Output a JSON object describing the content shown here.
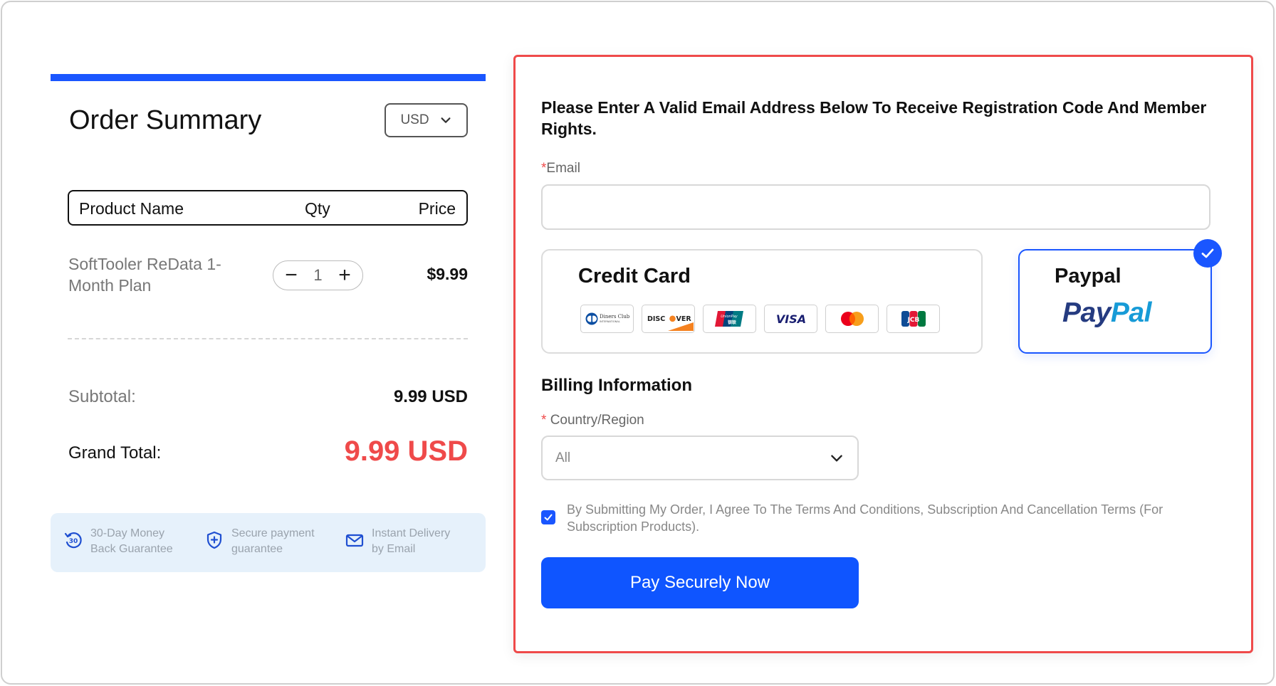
{
  "order": {
    "title": "Order Summary",
    "currency": "USD",
    "columns": {
      "name": "Product Name",
      "qty": "Qty",
      "price": "Price"
    },
    "product": {
      "name": "SoftTooler ReData 1-Month Plan",
      "qty": "1",
      "price": "$9.99",
      "minus": "−",
      "plus": "+"
    },
    "subtotal_label": "Subtotal:",
    "subtotal_value": "9.99 USD",
    "grand_label": "Grand Total:",
    "grand_value": "9.99 USD",
    "guarantees": [
      {
        "icon": "money-back-icon",
        "line1": "30-Day Money",
        "line2": "Back Guarantee"
      },
      {
        "icon": "shield-plus-icon",
        "line1": "Secure payment",
        "line2": "guarantee"
      },
      {
        "icon": "email-icon",
        "line1": "Instant Delivery",
        "line2": "by Email"
      }
    ]
  },
  "checkout": {
    "intro": "Please Enter A Valid Email Address Below To Receive Registration Code And Member Rights.",
    "email_label": "Email",
    "email_required_mark": "*",
    "email_value": "",
    "methods": {
      "credit_card": "Credit Card",
      "paypal": "Paypal",
      "paypal_logo_1": "Pay",
      "paypal_logo_2": "Pal",
      "selected": "paypal",
      "card_brands": [
        "Diners Club",
        "DISCOVER",
        "UnionPay",
        "VISA",
        "Mastercard",
        "JCB"
      ]
    },
    "billing_title": "Billing Information",
    "country_label": "Country/Region",
    "country_required_mark": "*",
    "country_value": "All",
    "agree_checked": true,
    "agree_text": "By Submitting My Order, I Agree To The Terms And Conditions, Subscription And Cancellation Terms (For Subscription Products).",
    "pay_button": "Pay Securely Now"
  },
  "colors": {
    "accent": "#1a56ff",
    "danger": "#ef4a4a",
    "guarantee_bg": "#e6f1fb",
    "paypal_dark": "#253b80",
    "paypal_light": "#179bd7"
  }
}
